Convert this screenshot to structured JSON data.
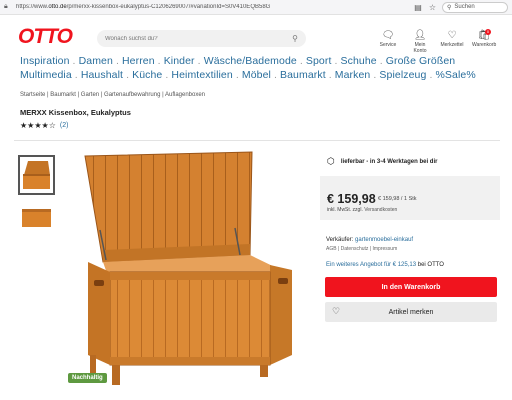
{
  "browser": {
    "url_prefix": "https://www.",
    "url_domain": "otto.de",
    "url_rest": "/p/merxx-kissenbox-eukalyptus-C1206269007/#variationId=S0V410EQB58G",
    "search_label": "Suchen"
  },
  "header": {
    "logo": "OTTO",
    "search_placeholder": "Wonach suchst du?",
    "icons": [
      {
        "label": "Service",
        "icon": "speech-bubble-icon"
      },
      {
        "label": "Mein Konto",
        "icon": "user-icon"
      },
      {
        "label": "Merkzettel",
        "icon": "heart-icon"
      },
      {
        "label": "Warenkorb",
        "icon": "cart-icon",
        "badge": "0"
      }
    ]
  },
  "nav": {
    "items": [
      "Inspiration",
      "Damen",
      "Herren",
      "Kinder",
      "Wäsche/Bademode",
      "Sport",
      "Schuhe",
      "Große Größen",
      "Multimedia",
      "Haushalt",
      "Küche",
      "Heimtextilien",
      "Möbel",
      "Baumarkt",
      "Marken",
      "Spielzeug",
      "%Sale%"
    ],
    "separator": "."
  },
  "breadcrumb": "Startseite | Baumarkt | Garten | Gartenaufbewahrung | Auflagenboxen",
  "product": {
    "title": "MERXX Kissenbox, Eukalyptus",
    "rating_count": "(2)",
    "rating_value": 4,
    "rating_max": 5,
    "tag": "Nachhaltig"
  },
  "buybox": {
    "delivery": "lieferbar - in 3-4 Werktagen bei dir",
    "price": "€ 159,98",
    "unit_price": "€ 159,98 / 1 Stk",
    "vat_text": "inkl. MwSt. zzgl.",
    "shipping_link": "Versandkosten",
    "seller_label": "Verkäufer:",
    "seller_name": "gartenmoebel-einkauf",
    "seller_links": "AGB | Datenschutz | Impressum",
    "offer_text": "Ein weiteres Angebot für € 125,13",
    "offer_suffix": "bei OTTO",
    "cart_button": "In den Warenkorb",
    "wishlist_button": "Artikel merken"
  },
  "colors": {
    "brand": "#f0141e",
    "link": "#2a6e9c",
    "wood": "#d9822b",
    "sustainable": "#5e9940"
  }
}
